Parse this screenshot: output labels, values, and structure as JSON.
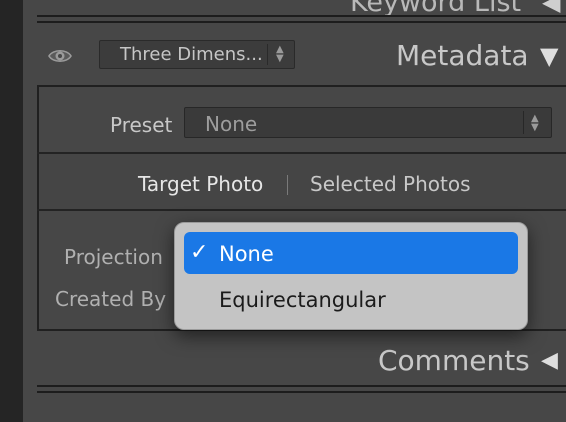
{
  "top_section": {
    "title": "Keyword List",
    "toggle_icon": "triangle-left-icon"
  },
  "metadata_header": {
    "eye_icon": "eye-icon",
    "preset_dropdown": {
      "selected": "Three Dimens...",
      "arrows_icon": "updown-arrows-icon"
    },
    "title": "Metadata",
    "toggle_icon": "triangle-down-icon"
  },
  "preset_row": {
    "label": "Preset",
    "value": "None",
    "arrows_icon": "updown-arrows-icon"
  },
  "target_tabs": [
    {
      "label": "Target Photo",
      "active": true
    },
    {
      "label": "Selected Photos",
      "active": false
    }
  ],
  "fields": [
    {
      "label": "Projection",
      "value": "None"
    },
    {
      "label": "Created By",
      "value": ""
    }
  ],
  "projection_popup": {
    "options": [
      {
        "label": "None",
        "checked": true
      },
      {
        "label": "Equirectangular",
        "checked": false
      }
    ],
    "check_icon": "checkmark-icon",
    "highlight_color": "#1a78e6"
  },
  "comments_section": {
    "title": "Comments",
    "toggle_icon": "triangle-left-icon"
  }
}
